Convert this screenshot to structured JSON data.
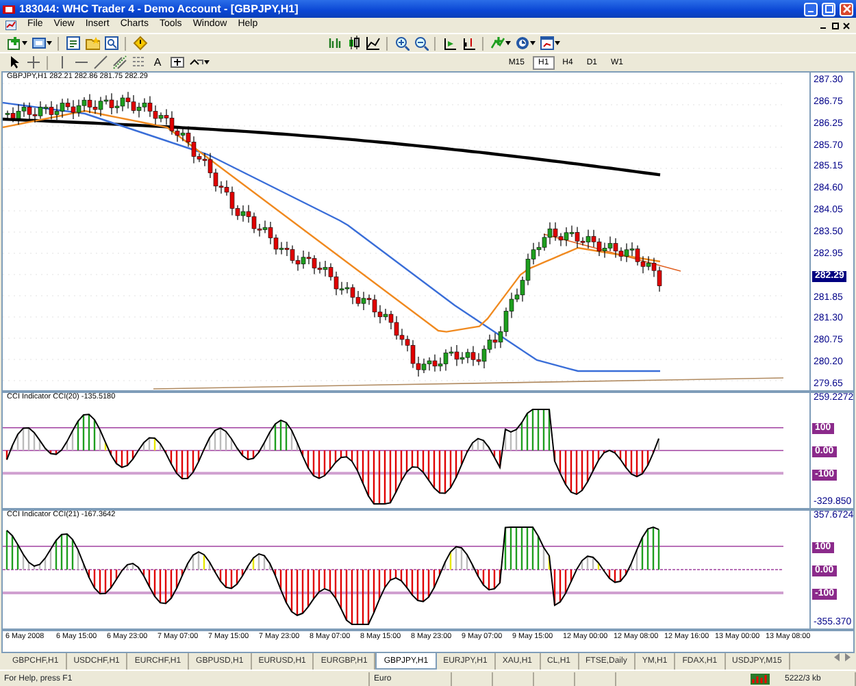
{
  "window": {
    "title": "183044: WHC Trader 4 - Demo Account - [GBPJPY,H1]"
  },
  "menu": [
    "File",
    "View",
    "Insert",
    "Charts",
    "Tools",
    "Window",
    "Help"
  ],
  "drawing_toolbar": {
    "text_tool": "A"
  },
  "timeframes": [
    {
      "label": "M15",
      "selected": false
    },
    {
      "label": "H1",
      "selected": true
    },
    {
      "label": "H4",
      "selected": false
    },
    {
      "label": "D1",
      "selected": false
    },
    {
      "label": "W1",
      "selected": false
    }
  ],
  "chart": {
    "header": "GBPJPY,H1  282.21 282.86 281.75 282.29",
    "price_axis": [
      {
        "label": "287.30",
        "kind": "tick"
      },
      {
        "label": "286.75",
        "kind": "tick"
      },
      {
        "label": "286.25",
        "kind": "tick"
      },
      {
        "label": "285.70",
        "kind": "tick"
      },
      {
        "label": "285.15",
        "kind": "tick"
      },
      {
        "label": "284.60",
        "kind": "tick"
      },
      {
        "label": "284.05",
        "kind": "tick"
      },
      {
        "label": "283.50",
        "kind": "tick"
      },
      {
        "label": "282.95",
        "kind": "tick"
      },
      {
        "label": "282.29",
        "kind": "current"
      },
      {
        "label": "281.85",
        "kind": "tick"
      },
      {
        "label": "281.30",
        "kind": "tick"
      },
      {
        "label": "280.75",
        "kind": "tick"
      },
      {
        "label": "280.20",
        "kind": "tick"
      },
      {
        "label": "279.65",
        "kind": "tick"
      }
    ]
  },
  "indicators": [
    {
      "header": "CCI Indicator  CCI(20) -135.5180",
      "axis": [
        {
          "label": "259.2272",
          "kind": "range"
        },
        {
          "label": "100",
          "kind": "level"
        },
        {
          "label": "0.00",
          "kind": "level"
        },
        {
          "label": "-100",
          "kind": "level"
        },
        {
          "label": "-329.850",
          "kind": "range"
        }
      ]
    },
    {
      "header": "CCI Indicator  CCI(21) -167.3642",
      "axis": [
        {
          "label": "357.6724",
          "kind": "range"
        },
        {
          "label": "100",
          "kind": "level"
        },
        {
          "label": "0.00",
          "kind": "level"
        },
        {
          "label": "-100",
          "kind": "level"
        },
        {
          "label": "-355.370",
          "kind": "range"
        }
      ]
    }
  ],
  "time_axis": [
    "6 May 2008",
    "6 May 15:00",
    "6 May 23:00",
    "7 May 07:00",
    "7 May 15:00",
    "7 May 23:00",
    "8 May 07:00",
    "8 May 15:00",
    "8 May 23:00",
    "9 May 07:00",
    "9 May 15:00",
    "12 May 00:00",
    "12 May 08:00",
    "12 May 16:00",
    "13 May 00:00",
    "13 May 08:00"
  ],
  "symbol_tabs": [
    {
      "label": "GBPCHF,H1",
      "selected": false
    },
    {
      "label": "USDCHF,H1",
      "selected": false
    },
    {
      "label": "EURCHF,H1",
      "selected": false
    },
    {
      "label": "GBPUSD,H1",
      "selected": false
    },
    {
      "label": "EURUSD,H1",
      "selected": false
    },
    {
      "label": "EURGBP,H1",
      "selected": false
    },
    {
      "label": "GBPJPY,H1",
      "selected": true
    },
    {
      "label": "EURJPY,H1",
      "selected": false
    },
    {
      "label": "XAU,H1",
      "selected": false
    },
    {
      "label": "CL,H1",
      "selected": false
    },
    {
      "label": "FTSE,Daily",
      "selected": false
    },
    {
      "label": "YM,H1",
      "selected": false
    },
    {
      "label": "FDAX,H1",
      "selected": false
    },
    {
      "label": "USDJPY,M15",
      "selected": false
    }
  ],
  "status_bar": {
    "help": "For Help, press F1",
    "profile": "Euro",
    "traffic": "5222/3 kb"
  }
}
